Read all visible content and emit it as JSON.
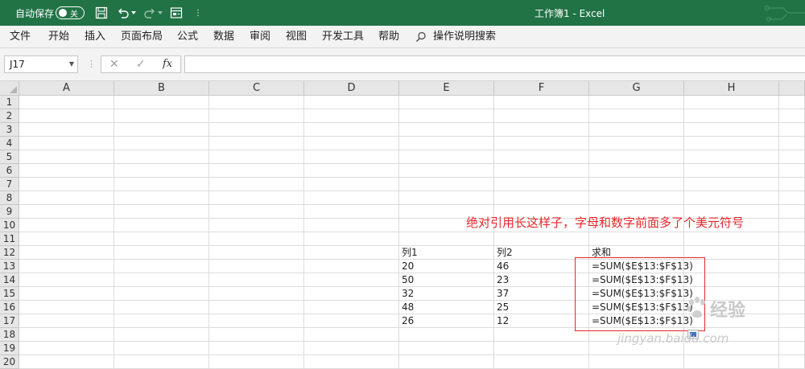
{
  "titlebar": {
    "autosave_label": "自动保存",
    "autosave_state": "关",
    "more_glyph": "⋮",
    "title": "工作簿1  -  Excel"
  },
  "menu": [
    {
      "label": "文件",
      "name": "menu-file"
    },
    {
      "label": "开始",
      "name": "menu-home"
    },
    {
      "label": "插入",
      "name": "menu-insert"
    },
    {
      "label": "页面布局",
      "name": "menu-page-layout"
    },
    {
      "label": "公式",
      "name": "menu-formulas"
    },
    {
      "label": "数据",
      "name": "menu-data"
    },
    {
      "label": "审阅",
      "name": "menu-review"
    },
    {
      "label": "视图",
      "name": "menu-view"
    },
    {
      "label": "开发工具",
      "name": "menu-developer"
    },
    {
      "label": "帮助",
      "name": "menu-help"
    }
  ],
  "tell_me": {
    "label": "操作说明搜索",
    "icon": "lightbulb-icon"
  },
  "formula_bar": {
    "name_box": "J17",
    "cancel_glyph": "✕",
    "enter_glyph": "✓",
    "fx_label": "fx",
    "value": ""
  },
  "columns": [
    "A",
    "B",
    "C",
    "D",
    "E",
    "F",
    "G",
    "H"
  ],
  "rows": [
    "1",
    "2",
    "3",
    "4",
    "5",
    "6",
    "7",
    "8",
    "9",
    "10",
    "11",
    "12",
    "13",
    "14",
    "15",
    "16",
    "17",
    "18",
    "19",
    "20"
  ],
  "table": {
    "headers": {
      "col1": "列1",
      "col2": "列2",
      "sum": "求和"
    },
    "data": [
      {
        "col1": "20",
        "col2": "46",
        "sum": "=SUM($E$13:$F$13)"
      },
      {
        "col1": "50",
        "col2": "23",
        "sum": "=SUM($E$13:$F$13)"
      },
      {
        "col1": "32",
        "col2": "37",
        "sum": "=SUM($E$13:$F$13)"
      },
      {
        "col1": "48",
        "col2": "25",
        "sum": "=SUM($E$13:$F$13)"
      },
      {
        "col1": "26",
        "col2": "12",
        "sum": "=SUM($E$13:$F$13)"
      }
    ]
  },
  "annotation": "绝对引用长这样子，字母和数字前面多了个美元符号",
  "watermark": {
    "brand": "经验",
    "url": "jingyan.baidu.com"
  },
  "colors": {
    "excel_green": "#217346",
    "annotation_red": "#e8262a"
  }
}
